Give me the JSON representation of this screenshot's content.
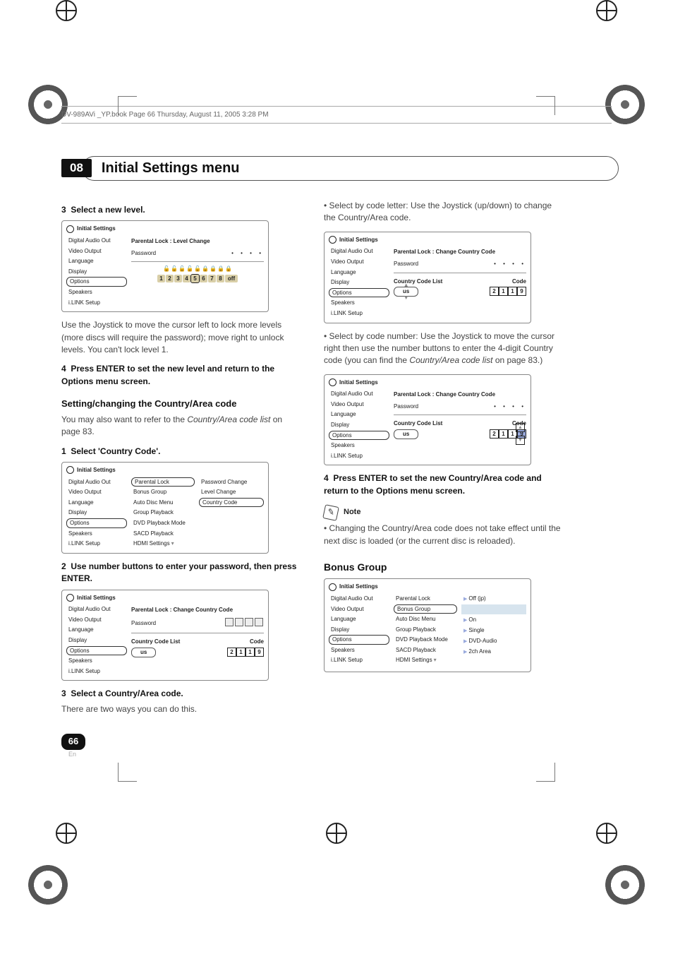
{
  "print_header": "DV-989AVi _YP.book  Page 66  Thursday, August 11, 2005  3:28 PM",
  "chapter_num": "08",
  "chapter_title": "Initial Settings menu",
  "left": {
    "s3_label": "3",
    "s3_text": "Select a new level.",
    "p_after_s3": "Use the Joystick to move the cursor left to lock more levels (more discs will require the password); move right to unlock levels. You can't lock level 1.",
    "s4_label": "4",
    "s4_text": "Press ENTER to set the new level and return to the Options menu screen.",
    "h_setcc": "Setting/changing the Country/Area code",
    "p_setcc": "You may also want to refer to the ",
    "p_setcc_i": "Country/Area code list",
    "p_setcc_end": " on page 83.",
    "s1_label": "1",
    "s1_text": "Select 'Country Code'.",
    "s2_label": "2",
    "s2_text": "Use number buttons to enter your password, then press ENTER.",
    "s3b_label": "3",
    "s3b_text": "Select a Country/Area code.",
    "p_twoways": "There are two ways you can do this."
  },
  "right": {
    "bullet_letter": "Select by code letter: Use the Joystick (up/down) to change the Country/Area code.",
    "bullet_number_a": "Select by code number: Use the Joystick to move the cursor right then use the number buttons to enter the 4-digit Country code (you can find the ",
    "bullet_number_i": "Country/Area code list",
    "bullet_number_b": " on page 83.)",
    "s4_label": "4",
    "s4_text": "Press ENTER to set the new Country/Area code and return to the Options menu screen.",
    "note_label": "Note",
    "note_text": "Changing the Country/Area code does not take effect until the next disc is loaded (or the current disc is reloaded).",
    "h_bonus": "Bonus Group"
  },
  "menu": {
    "title": "Initial Settings",
    "side_items": [
      "Digital Audio Out",
      "Video Output",
      "Language",
      "Display",
      "Options",
      "Speakers",
      "i.LINK Setup"
    ],
    "opts_items": [
      "Parental Lock",
      "Bonus Group",
      "Auto Disc Menu",
      "Group Playback",
      "DVD Playback Mode",
      "SACD Playback",
      "HDMI Settings"
    ],
    "parental_sub": [
      "Password Change",
      "Level Change",
      "Country Code"
    ],
    "level_title": "Parental Lock : Level Change",
    "pwd_label": "Password",
    "cc_title": "Parental Lock : Change Country Code",
    "ccl_label": "Country Code List",
    "code_label": "Code",
    "cc_value": "us",
    "code_digits": [
      "2",
      "1",
      "1",
      "9"
    ],
    "bonus_vals": {
      "parental": "Off (jp)",
      "bonus": "",
      "auto": "On",
      "group": "Single",
      "dvd": "DVD-Audio",
      "sacd": "2ch Area",
      "hdmi": ""
    }
  },
  "page_number": "66",
  "page_lang": "En"
}
